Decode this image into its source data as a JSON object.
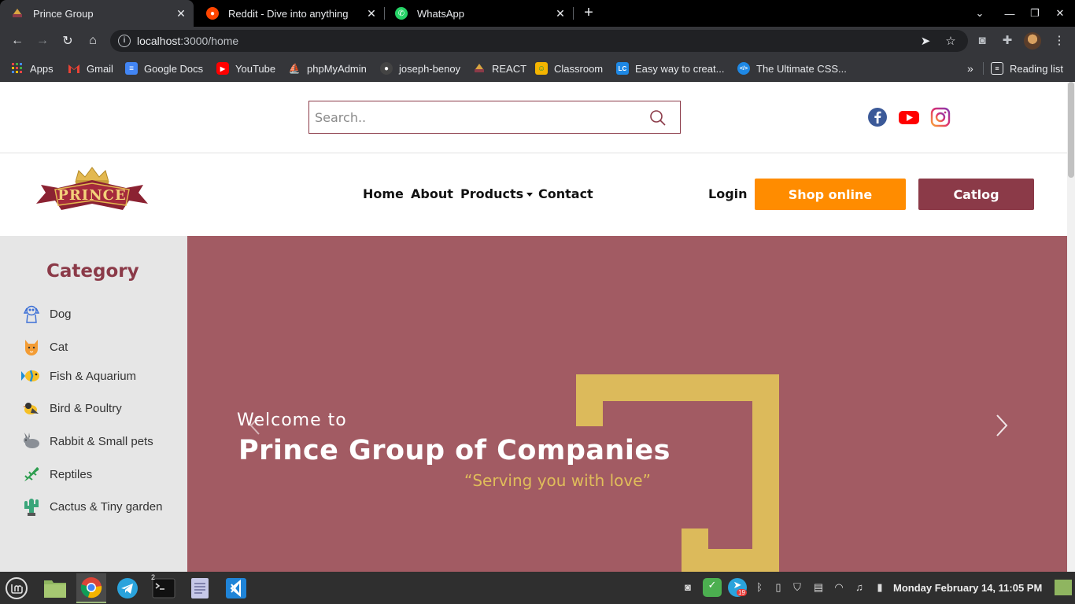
{
  "browser": {
    "tabs": [
      {
        "title": "Prince Group",
        "icon": "prince-logo-icon"
      },
      {
        "title": "Reddit - Dive into anything",
        "icon": "reddit-icon"
      },
      {
        "title": "WhatsApp",
        "icon": "whatsapp-icon"
      }
    ],
    "url_host": "localhost",
    "url_path": ":3000/home",
    "bookmarks": [
      {
        "label": "Apps",
        "icon": "apps-grid-icon"
      },
      {
        "label": "Gmail",
        "icon": "gmail-icon"
      },
      {
        "label": "Google Docs",
        "icon": "google-docs-icon"
      },
      {
        "label": "YouTube",
        "icon": "youtube-icon"
      },
      {
        "label": "phpMyAdmin",
        "icon": "phpmyadmin-icon"
      },
      {
        "label": "joseph-benoy",
        "icon": "github-icon"
      },
      {
        "label": "REACT",
        "icon": "prince-logo-icon"
      },
      {
        "label": "Classroom",
        "icon": "classroom-icon"
      },
      {
        "label": "Easy way to creat...",
        "icon": "lc-icon"
      },
      {
        "label": "The Ultimate CSS...",
        "icon": "code-icon"
      }
    ],
    "reading_list": "Reading list"
  },
  "site": {
    "search_placeholder": "Search..",
    "logo_text": "PRINCE",
    "nav": {
      "home": "Home",
      "about": "About",
      "products": "Products",
      "contact": "Contact",
      "login": "Login",
      "shop_online": "Shop online",
      "catalog": "Catlog"
    },
    "sidebar": {
      "heading": "Category",
      "items": [
        {
          "label": "Dog",
          "icon": "dog-icon"
        },
        {
          "label": "Cat",
          "icon": "cat-icon"
        },
        {
          "label": "Fish & Aquarium",
          "icon": "fish-icon"
        },
        {
          "label": "Bird & Poultry",
          "icon": "bird-icon"
        },
        {
          "label": "Rabbit & Small pets",
          "icon": "rabbit-icon"
        },
        {
          "label": "Reptiles",
          "icon": "lizard-icon"
        },
        {
          "label": "Cactus & Tiny garden",
          "icon": "cactus-icon"
        }
      ]
    },
    "hero": {
      "welcome": "Welcome to",
      "title": "Prince Group of Companies",
      "tagline": "“Serving you with love”"
    },
    "colors": {
      "brand_maroon": "#8b3a48",
      "hero_bg": "#a25b63",
      "shop_orange": "#ff8c00",
      "frame_gold": "#dcba5b"
    }
  },
  "taskbar": {
    "clock": "Monday February 14, 11:05 PM",
    "telegram_badge": "19",
    "terminal_badge": "2"
  }
}
